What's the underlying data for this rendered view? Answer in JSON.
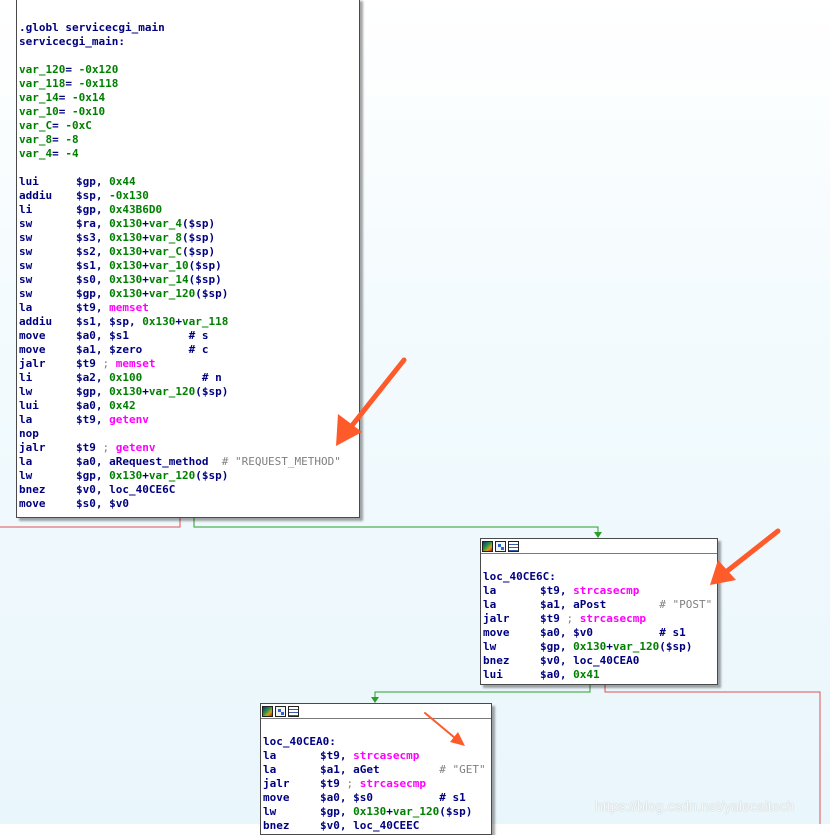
{
  "blocks": [
    {
      "id": "servicecgi_main",
      "lines": [
        [
          {
            "t": ".globl servicecgi_main",
            "c": "lbl"
          }
        ],
        [
          {
            "t": "servicecgi_main:",
            "c": "lbl"
          }
        ],
        [],
        [
          {
            "t": "var_120",
            "c": "var"
          },
          {
            "t": "= ",
            "c": "reg"
          },
          {
            "t": "-0x120",
            "c": "num"
          }
        ],
        [
          {
            "t": "var_118",
            "c": "var"
          },
          {
            "t": "= ",
            "c": "reg"
          },
          {
            "t": "-0x118",
            "c": "num"
          }
        ],
        [
          {
            "t": "var_14",
            "c": "var"
          },
          {
            "t": "= ",
            "c": "reg"
          },
          {
            "t": "-0x14",
            "c": "num"
          }
        ],
        [
          {
            "t": "var_10",
            "c": "var"
          },
          {
            "t": "= ",
            "c": "reg"
          },
          {
            "t": "-0x10",
            "c": "num"
          }
        ],
        [
          {
            "t": "var_C",
            "c": "var"
          },
          {
            "t": "= ",
            "c": "reg"
          },
          {
            "t": "-0xC",
            "c": "num"
          }
        ],
        [
          {
            "t": "var_8",
            "c": "var"
          },
          {
            "t": "= ",
            "c": "reg"
          },
          {
            "t": "-8",
            "c": "num"
          }
        ],
        [
          {
            "t": "var_4",
            "c": "var"
          },
          {
            "t": "= ",
            "c": "reg"
          },
          {
            "t": "-4",
            "c": "num"
          }
        ],
        [],
        [
          {
            "t": "lui",
            "c": "mn"
          },
          {
            "t": "$gp, ",
            "c": "reg"
          },
          {
            "t": "0x44",
            "c": "num"
          }
        ],
        [
          {
            "t": "addiu",
            "c": "mn"
          },
          {
            "t": "$sp, ",
            "c": "reg"
          },
          {
            "t": "-0x130",
            "c": "num"
          }
        ],
        [
          {
            "t": "li",
            "c": "mn"
          },
          {
            "t": "$gp, ",
            "c": "reg"
          },
          {
            "t": "0x43B6D0",
            "c": "num"
          }
        ],
        [
          {
            "t": "sw",
            "c": "mn"
          },
          {
            "t": "$ra, ",
            "c": "reg"
          },
          {
            "t": "0x130",
            "c": "num"
          },
          {
            "t": "+",
            "c": "reg"
          },
          {
            "t": "var_4",
            "c": "var"
          },
          {
            "t": "($sp)",
            "c": "reg"
          }
        ],
        [
          {
            "t": "sw",
            "c": "mn"
          },
          {
            "t": "$s3, ",
            "c": "reg"
          },
          {
            "t": "0x130",
            "c": "num"
          },
          {
            "t": "+",
            "c": "reg"
          },
          {
            "t": "var_8",
            "c": "var"
          },
          {
            "t": "($sp)",
            "c": "reg"
          }
        ],
        [
          {
            "t": "sw",
            "c": "mn"
          },
          {
            "t": "$s2, ",
            "c": "reg"
          },
          {
            "t": "0x130",
            "c": "num"
          },
          {
            "t": "+",
            "c": "reg"
          },
          {
            "t": "var_C",
            "c": "var"
          },
          {
            "t": "($sp)",
            "c": "reg"
          }
        ],
        [
          {
            "t": "sw",
            "c": "mn"
          },
          {
            "t": "$s1, ",
            "c": "reg"
          },
          {
            "t": "0x130",
            "c": "num"
          },
          {
            "t": "+",
            "c": "reg"
          },
          {
            "t": "var_10",
            "c": "var"
          },
          {
            "t": "($sp)",
            "c": "reg"
          }
        ],
        [
          {
            "t": "sw",
            "c": "mn"
          },
          {
            "t": "$s0, ",
            "c": "reg"
          },
          {
            "t": "0x130",
            "c": "num"
          },
          {
            "t": "+",
            "c": "reg"
          },
          {
            "t": "var_14",
            "c": "var"
          },
          {
            "t": "($sp)",
            "c": "reg"
          }
        ],
        [
          {
            "t": "sw",
            "c": "mn"
          },
          {
            "t": "$gp, ",
            "c": "reg"
          },
          {
            "t": "0x130",
            "c": "num"
          },
          {
            "t": "+",
            "c": "reg"
          },
          {
            "t": "var_120",
            "c": "var"
          },
          {
            "t": "($sp)",
            "c": "reg"
          }
        ],
        [
          {
            "t": "la",
            "c": "mn"
          },
          {
            "t": "$t9, ",
            "c": "reg"
          },
          {
            "t": "memset",
            "c": "fn"
          }
        ],
        [
          {
            "t": "addiu",
            "c": "mn"
          },
          {
            "t": "$s1, $sp, ",
            "c": "reg"
          },
          {
            "t": "0x130",
            "c": "num"
          },
          {
            "t": "+",
            "c": "reg"
          },
          {
            "t": "var_118",
            "c": "var"
          }
        ],
        [
          {
            "t": "move",
            "c": "mn"
          },
          {
            "t": "$a0, $s1         ",
            "c": "reg"
          },
          {
            "t": "# s",
            "c": "reg"
          }
        ],
        [
          {
            "t": "move",
            "c": "mn"
          },
          {
            "t": "$a1, $zero       ",
            "c": "reg"
          },
          {
            "t": "# c",
            "c": "reg"
          }
        ],
        [
          {
            "t": "jalr",
            "c": "mn"
          },
          {
            "t": "$t9 ",
            "c": "reg"
          },
          {
            "t": "; ",
            "c": "cmt"
          },
          {
            "t": "memset",
            "c": "fn"
          }
        ],
        [
          {
            "t": "li",
            "c": "mn"
          },
          {
            "t": "$a2, ",
            "c": "reg"
          },
          {
            "t": "0x100",
            "c": "num"
          },
          {
            "t": "         # n",
            "c": "reg"
          }
        ],
        [
          {
            "t": "lw",
            "c": "mn"
          },
          {
            "t": "$gp, ",
            "c": "reg"
          },
          {
            "t": "0x130",
            "c": "num"
          },
          {
            "t": "+",
            "c": "reg"
          },
          {
            "t": "var_120",
            "c": "var"
          },
          {
            "t": "($sp)",
            "c": "reg"
          }
        ],
        [
          {
            "t": "lui",
            "c": "mn"
          },
          {
            "t": "$a0, ",
            "c": "reg"
          },
          {
            "t": "0x42",
            "c": "num"
          }
        ],
        [
          {
            "t": "la",
            "c": "mn"
          },
          {
            "t": "$t9, ",
            "c": "reg"
          },
          {
            "t": "getenv",
            "c": "fn"
          }
        ],
        [
          {
            "t": "nop",
            "c": "mn"
          }
        ],
        [
          {
            "t": "jalr",
            "c": "mn"
          },
          {
            "t": "$t9 ",
            "c": "reg"
          },
          {
            "t": "; ",
            "c": "cmt"
          },
          {
            "t": "getenv",
            "c": "fn"
          }
        ],
        [
          {
            "t": "la",
            "c": "mn"
          },
          {
            "t": "$a0, aRequest_method  ",
            "c": "reg"
          },
          {
            "t": "# \"REQUEST_METHOD\"",
            "c": "str"
          }
        ],
        [
          {
            "t": "lw",
            "c": "mn"
          },
          {
            "t": "$gp, ",
            "c": "reg"
          },
          {
            "t": "0x130",
            "c": "num"
          },
          {
            "t": "+",
            "c": "reg"
          },
          {
            "t": "var_120",
            "c": "var"
          },
          {
            "t": "($sp)",
            "c": "reg"
          }
        ],
        [
          {
            "t": "bnez",
            "c": "mn"
          },
          {
            "t": "$v0, loc_40CE6C",
            "c": "reg"
          }
        ],
        [
          {
            "t": "move",
            "c": "mn"
          },
          {
            "t": "$s0, $v0",
            "c": "reg"
          }
        ]
      ]
    },
    {
      "id": "loc_40CE6C",
      "lines": [
        [],
        [
          {
            "t": "loc_40CE6C:",
            "c": "lbl"
          }
        ],
        [
          {
            "t": "la",
            "c": "mn"
          },
          {
            "t": "$t9, ",
            "c": "reg"
          },
          {
            "t": "strcasecmp",
            "c": "fn"
          }
        ],
        [
          {
            "t": "la",
            "c": "mn"
          },
          {
            "t": "$a1, aPost        ",
            "c": "reg"
          },
          {
            "t": "# \"POST\"",
            "c": "str"
          }
        ],
        [
          {
            "t": "jalr",
            "c": "mn"
          },
          {
            "t": "$t9 ",
            "c": "reg"
          },
          {
            "t": "; ",
            "c": "cmt"
          },
          {
            "t": "strcasecmp",
            "c": "fn"
          }
        ],
        [
          {
            "t": "move",
            "c": "mn"
          },
          {
            "t": "$a0, $v0          ",
            "c": "reg"
          },
          {
            "t": "# s1",
            "c": "reg"
          }
        ],
        [
          {
            "t": "lw",
            "c": "mn"
          },
          {
            "t": "$gp, ",
            "c": "reg"
          },
          {
            "t": "0x130",
            "c": "num"
          },
          {
            "t": "+",
            "c": "reg"
          },
          {
            "t": "var_120",
            "c": "var"
          },
          {
            "t": "($sp)",
            "c": "reg"
          }
        ],
        [
          {
            "t": "bnez",
            "c": "mn"
          },
          {
            "t": "$v0, loc_40CEA0",
            "c": "reg"
          }
        ],
        [
          {
            "t": "lui",
            "c": "mn"
          },
          {
            "t": "$a0, ",
            "c": "reg"
          },
          {
            "t": "0x41",
            "c": "num"
          }
        ]
      ]
    },
    {
      "id": "loc_40CEA0",
      "lines": [
        [],
        [
          {
            "t": "loc_40CEA0:",
            "c": "lbl"
          }
        ],
        [
          {
            "t": "la",
            "c": "mn"
          },
          {
            "t": "$t9, ",
            "c": "reg"
          },
          {
            "t": "strcasecmp",
            "c": "fn"
          }
        ],
        [
          {
            "t": "la",
            "c": "mn"
          },
          {
            "t": "$a1, aGet         ",
            "c": "reg"
          },
          {
            "t": "# \"GET\"",
            "c": "str"
          }
        ],
        [
          {
            "t": "jalr",
            "c": "mn"
          },
          {
            "t": "$t9 ",
            "c": "reg"
          },
          {
            "t": "; ",
            "c": "cmt"
          },
          {
            "t": "strcasecmp",
            "c": "fn"
          }
        ],
        [
          {
            "t": "move",
            "c": "mn"
          },
          {
            "t": "$a0, $s0          ",
            "c": "reg"
          },
          {
            "t": "# s1",
            "c": "reg"
          }
        ],
        [
          {
            "t": "lw",
            "c": "mn"
          },
          {
            "t": "$gp, ",
            "c": "reg"
          },
          {
            "t": "0x130",
            "c": "num"
          },
          {
            "t": "+",
            "c": "reg"
          },
          {
            "t": "var_120",
            "c": "var"
          },
          {
            "t": "($sp)",
            "c": "reg"
          }
        ],
        [
          {
            "t": "bnez",
            "c": "mn"
          },
          {
            "t": "$v0, loc_40CEEC",
            "c": "reg"
          }
        ]
      ]
    }
  ],
  "watermark": "https://blog.csdn.net/yalecaltech",
  "colors": {
    "edge_true": "#2aa02a",
    "edge_false": "#e05050",
    "edge_uncond": "#2a6ad0",
    "arrow": "#ff5a2a",
    "text": "#000080",
    "number": "#008000",
    "function": "#ff00ff",
    "string": "#808080"
  }
}
